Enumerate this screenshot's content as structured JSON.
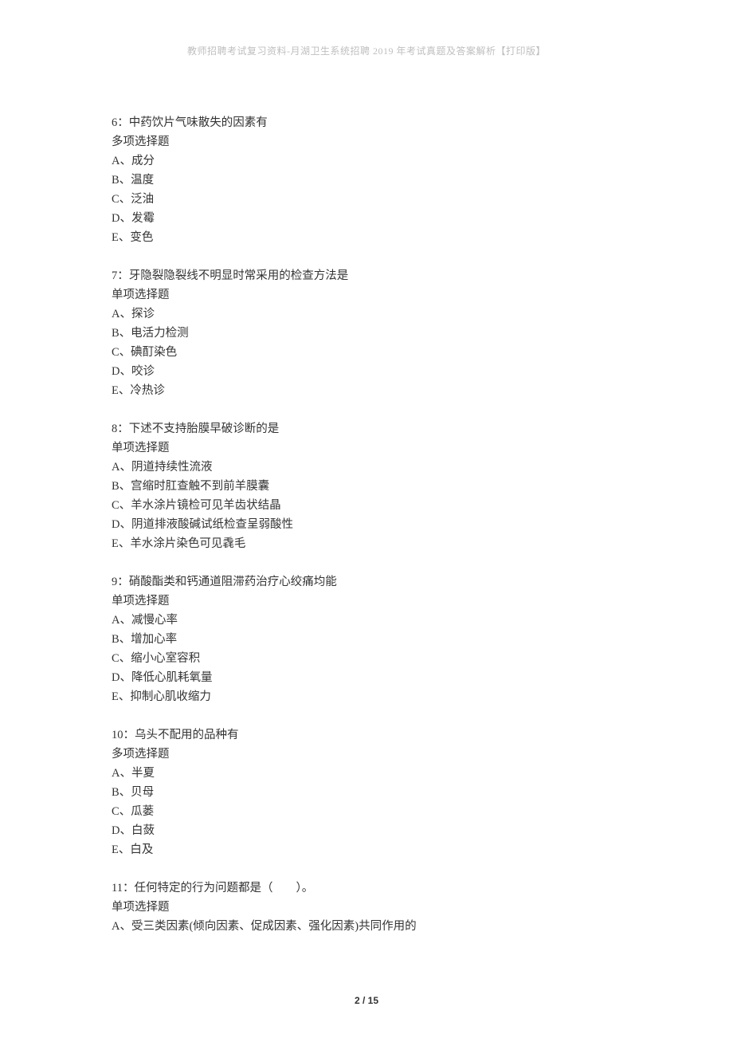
{
  "header": "教师招聘考试复习资料-月湖卫生系统招聘 2019 年考试真题及答案解析【打印版】",
  "questions": [
    {
      "stem": "6：中药饮片气味散失的因素有",
      "type": "多项选择题",
      "options": [
        "A、成分",
        "B、温度",
        "C、泛油",
        "D、发霉",
        "E、变色"
      ]
    },
    {
      "stem": "7：牙隐裂隐裂线不明显时常采用的检查方法是",
      "type": "单项选择题",
      "options": [
        "A、探诊",
        "B、电活力检测",
        "C、碘酊染色",
        "D、咬诊",
        "E、冷热诊"
      ]
    },
    {
      "stem": "8：下述不支持胎膜早破诊断的是",
      "type": "单项选择题",
      "options": [
        "A、阴道持续性流液",
        "B、宫缩时肛查触不到前羊膜囊",
        "C、羊水涂片镜检可见羊齿状结晶",
        "D、阴道排液酸碱试纸检查呈弱酸性",
        "E、羊水涂片染色可见毳毛"
      ]
    },
    {
      "stem": "9：硝酸酯类和钙通道阻滞药治疗心绞痛均能",
      "type": "单项选择题",
      "options": [
        "A、减慢心率",
        "B、增加心率",
        "C、缩小心室容积",
        "D、降低心肌耗氧量",
        "E、抑制心肌收缩力"
      ]
    },
    {
      "stem": "10：乌头不配用的品种有",
      "type": "多项选择题",
      "options": [
        "A、半夏",
        "B、贝母",
        "C、瓜蒌",
        "D、白蔹",
        "E、白及"
      ]
    },
    {
      "stem": "11：任何特定的行为问题都是（　　）。",
      "type": "单项选择题",
      "options": [
        "A、受三类因素(倾向因素、促成因素、强化因素)共同作用的"
      ]
    }
  ],
  "pageNumber": "2 / 15"
}
